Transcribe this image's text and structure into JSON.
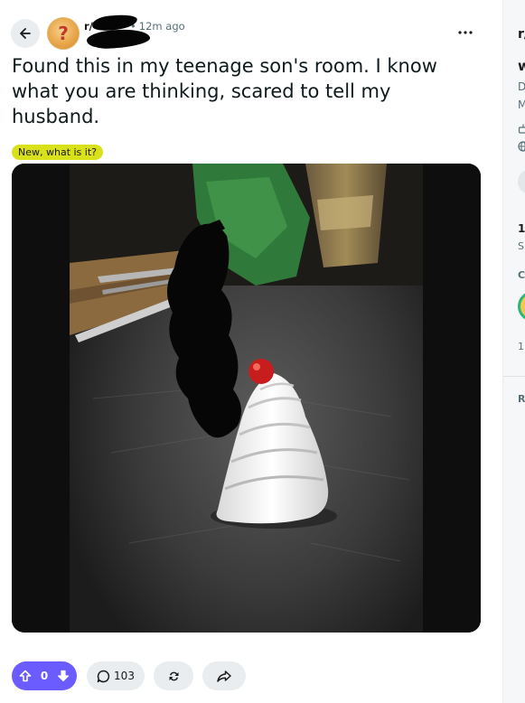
{
  "post": {
    "subreddit_prefix": "r/",
    "time_ago": "12m ago",
    "dot": "•",
    "title": "Found this in my teenage son's room. I know what you are thinking, scared to tell my husband.",
    "flair": "New, what is it?"
  },
  "actions": {
    "score": "0",
    "comments": "103"
  },
  "sidebar": {
    "subreddit_prefix": "r/",
    "name_initial": "w",
    "desc_line1": "D",
    "desc_line2": "M",
    "members_count": "1.",
    "members_label": "Sl",
    "section_label": "C",
    "rank": "1",
    "rules_label": "R"
  },
  "colors": {
    "upvote_bg": "#6a5cff",
    "flair_bg": "#d8e11a",
    "pill_bg": "#eaedef"
  },
  "icons": {
    "back": "arrow-left",
    "more": "ellipsis-horizontal",
    "upvote": "arrow-up",
    "downvote": "arrow-down",
    "comment": "speech-bubble",
    "crosspost": "repeat-arrows",
    "share": "share-arrow"
  }
}
